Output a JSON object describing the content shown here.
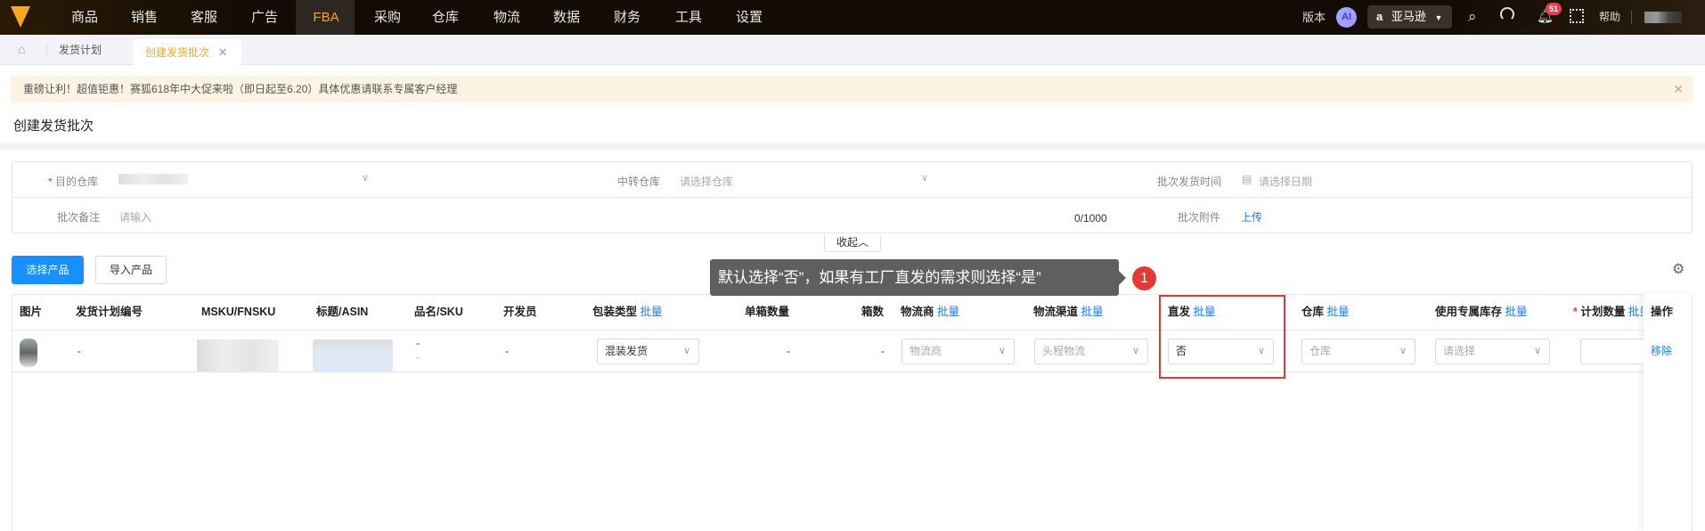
{
  "nav": {
    "items": [
      "商品",
      "销售",
      "客服",
      "广告",
      "FBA",
      "采购",
      "仓库",
      "物流",
      "数据",
      "财务",
      "工具",
      "设置"
    ],
    "active": "FBA",
    "right": {
      "version": "版本",
      "ai": "AI",
      "marketplace": "亚马逊",
      "notif_count": "51",
      "help": "帮助"
    }
  },
  "tabs": {
    "items": [
      {
        "label": "发货计划"
      },
      {
        "label": "创建发货批次",
        "active": true
      }
    ]
  },
  "banner": {
    "text": "重磅让利！超值钜惠！赛狐618年中大促来啦（即日起至6.20）具体优惠请联系专属客户经理"
  },
  "page_title": "创建发货批次",
  "form": {
    "dest_label": "目的仓库",
    "transit_label": "中转仓库",
    "transit_placeholder": "请选择仓库",
    "date_label": "批次发货时间",
    "date_placeholder": "请选择日期",
    "remark_label": "批次备注",
    "remark_placeholder": "请输入",
    "remark_count": "0/1000",
    "attach_label": "批次附件",
    "attach_link": "上传",
    "collapse": "收起"
  },
  "actions": {
    "select_product": "选择产品",
    "import_product": "导入产品"
  },
  "tooltip": {
    "text": "默认选择“否”，如果有工厂直发的需求则选择“是”",
    "step": "1"
  },
  "table": {
    "headers": [
      "图片",
      "发货计划编号",
      "MSKU/FNSKU",
      "标题/ASIN",
      "品名/SKU",
      "开发员",
      "包装类型",
      "单箱数量",
      "箱数",
      "物流商",
      "物流渠道",
      "直发",
      "仓库",
      "使用专属库存",
      "计划数量",
      "操作"
    ],
    "batch": "批量",
    "row": {
      "plan_no": "-",
      "name_sku": [
        "-",
        "-"
      ],
      "developer": "-",
      "pack_type": "混装发货",
      "per_box": "-",
      "boxes": "-",
      "carrier_ph": "物流商",
      "channel_ph": "头程物流",
      "direct": "否",
      "warehouse_ph": "仓库",
      "exclusive_ph": "请选择",
      "remove": "移除"
    }
  },
  "colors": {
    "accent": "#f5a623",
    "primary": "#1a7ef0",
    "highlight": "#e53935"
  }
}
